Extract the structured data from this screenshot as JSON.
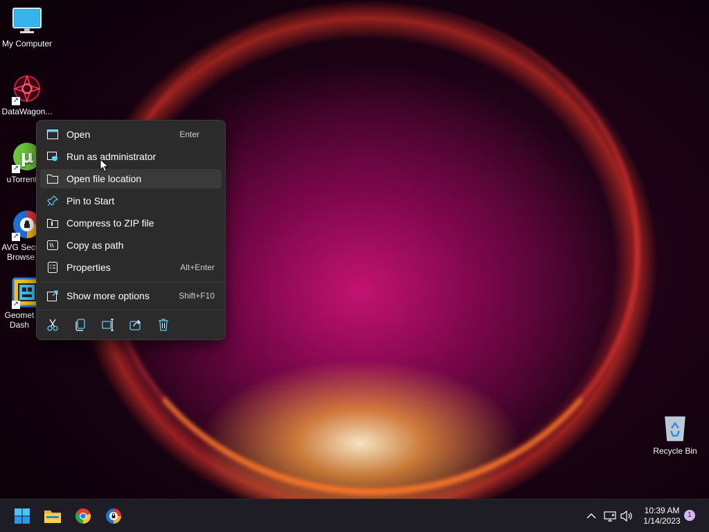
{
  "desktop": {
    "icons": [
      {
        "label": "My Computer",
        "icon": "monitor-icon"
      },
      {
        "label": "DataWagon...",
        "icon": "datawagon-app-icon"
      },
      {
        "label": "uTorrent W",
        "icon": "utorrent-icon"
      },
      {
        "label": "AVG Secu Browse",
        "icon": "avg-browser-icon"
      },
      {
        "label": "Geomet Dash",
        "icon": "geometry-dash-icon"
      },
      {
        "label": "Recycle Bin",
        "icon": "recycle-bin-icon"
      }
    ]
  },
  "context_menu": {
    "items": [
      {
        "label": "Open",
        "shortcut": "Enter",
        "icon": "open-window-icon"
      },
      {
        "label": "Run as administrator",
        "shortcut": "",
        "icon": "shield-window-icon"
      },
      {
        "label": "Open file location",
        "shortcut": "",
        "icon": "folder-icon"
      },
      {
        "label": "Pin to Start",
        "shortcut": "",
        "icon": "pin-icon"
      },
      {
        "label": "Compress to ZIP file",
        "shortcut": "",
        "icon": "zip-folder-icon"
      },
      {
        "label": "Copy as path",
        "shortcut": "",
        "icon": "path-icon"
      },
      {
        "label": "Properties",
        "shortcut": "Alt+Enter",
        "icon": "properties-icon"
      },
      {
        "label": "Show more options",
        "shortcut": "Shift+F10",
        "icon": "expand-icon"
      }
    ],
    "actions": [
      "cut-icon",
      "copy-icon",
      "rename-icon",
      "share-icon",
      "delete-icon"
    ],
    "hovered_item": "Open file location"
  },
  "taskbar": {
    "pinned": [
      "start-icon",
      "file-explorer-icon",
      "chrome-icon",
      "avg-browser-icon"
    ],
    "tray": [
      "chevron-up-icon",
      "network-icon",
      "volume-icon"
    ],
    "clock_time": "10:39 AM",
    "clock_date": "1/14/2023",
    "notification_count": "1"
  },
  "colors": {
    "menu_bg": "#2b2b2b",
    "menu_hover": "#3a3a3a",
    "taskbar_bg": "#1e1c24",
    "accent": "#60cdff"
  }
}
